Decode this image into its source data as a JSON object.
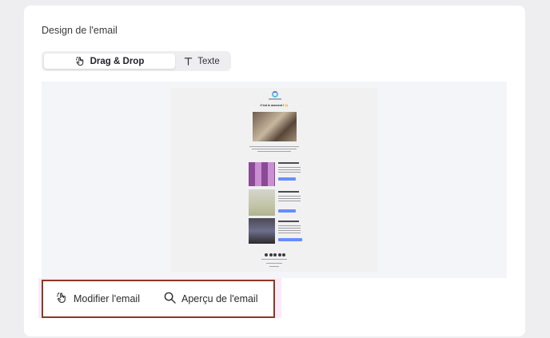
{
  "section": {
    "title": "Design de l'email"
  },
  "editor_mode": {
    "tabs": [
      {
        "label": "Drag & Drop",
        "active": true,
        "icon": "hand-pointer-icon"
      },
      {
        "label": "Texte",
        "active": false,
        "icon": "text-t-icon"
      }
    ]
  },
  "actions": {
    "edit_label": "Modifier l'email",
    "preview_label": "Aperçu de l'email"
  },
  "email_preview": {
    "heading": "C'est le moment ! 🙌"
  },
  "colors": {
    "accent": "#6a8cff",
    "highlight_border": "#8b3a22",
    "highlight_bg": "#fbeaf9"
  }
}
